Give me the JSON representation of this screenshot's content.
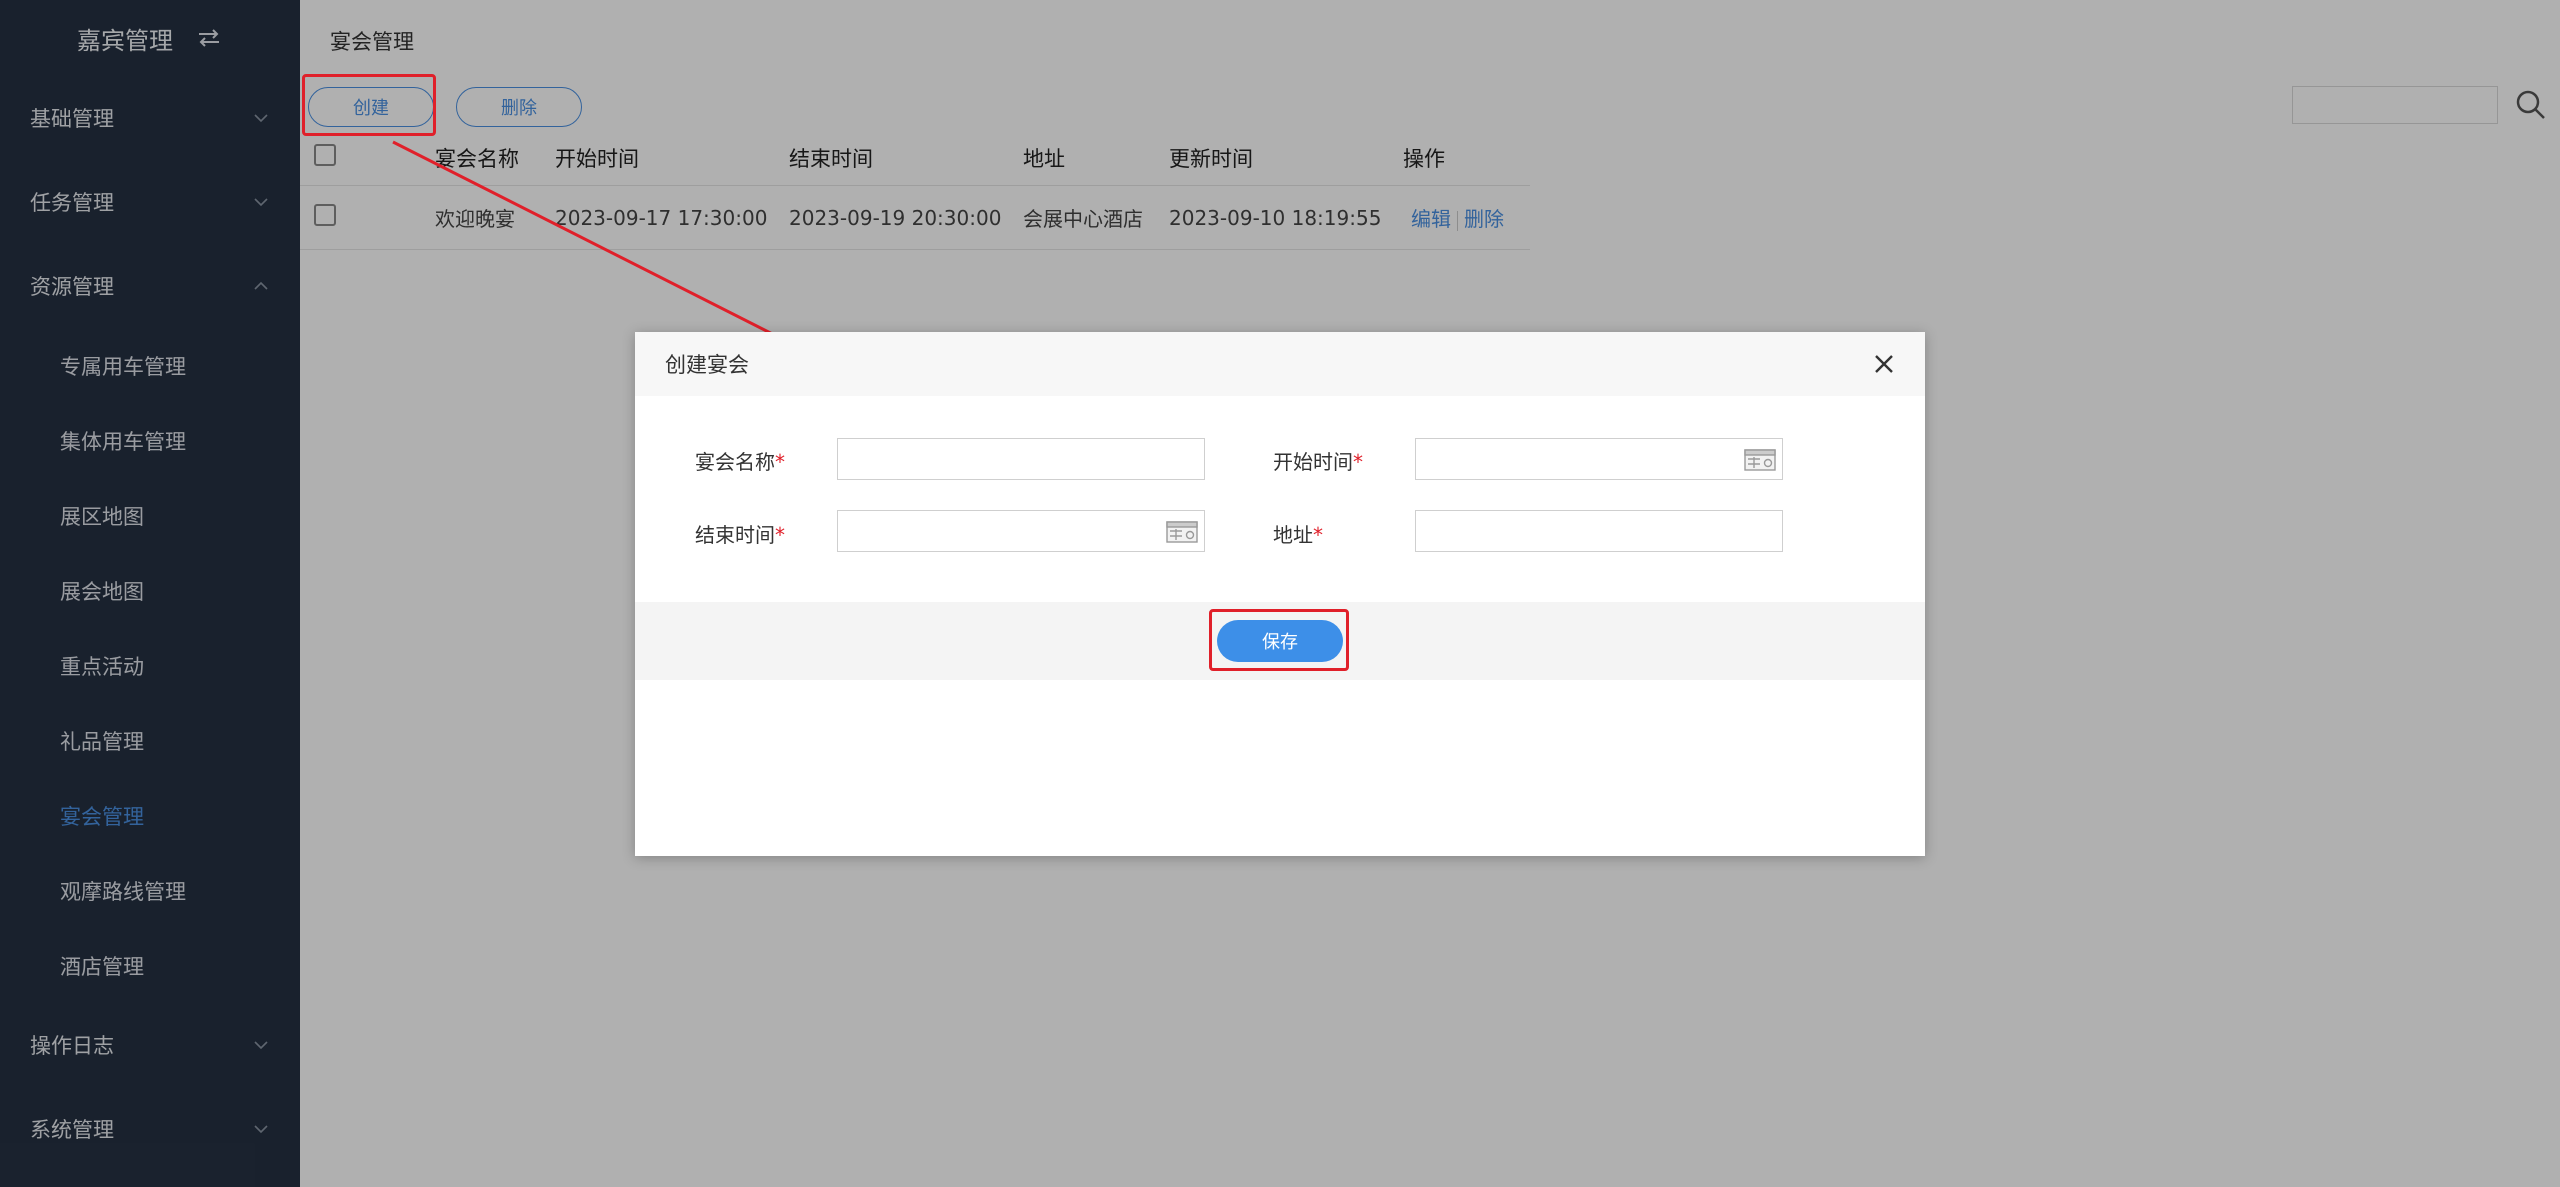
{
  "sidebar": {
    "title": "嘉宾管理",
    "groups": [
      {
        "label": "基础管理"
      },
      {
        "label": "任务管理"
      },
      {
        "label": "资源管理"
      },
      {
        "label": "操作日志"
      },
      {
        "label": "系统管理"
      }
    ],
    "sub_items": [
      {
        "label": "专属用车管理"
      },
      {
        "label": "集体用车管理"
      },
      {
        "label": "展区地图"
      },
      {
        "label": "展会地图"
      },
      {
        "label": "重点活动"
      },
      {
        "label": "礼品管理"
      },
      {
        "label": "宴会管理"
      },
      {
        "label": "观摩路线管理"
      },
      {
        "label": "酒店管理"
      }
    ]
  },
  "main": {
    "title": "宴会管理",
    "create_label": "创建",
    "delete_label": "删除",
    "table": {
      "headers": [
        "宴会名称",
        "开始时间",
        "结束时间",
        "地址",
        "更新时间",
        "操作"
      ],
      "rows": [
        {
          "name": "欢迎晚宴",
          "start": "2023-09-17 17:30:00",
          "end": "2023-09-19 20:30:00",
          "address": "会展中心酒店",
          "updated": "2023-09-10 18:19:55",
          "edit": "编辑",
          "delete": "删除"
        }
      ]
    }
  },
  "modal": {
    "title": "创建宴会",
    "fields": {
      "name": "宴会名称",
      "start": "开始时间",
      "end": "结束时间",
      "address": "地址"
    },
    "required_mark": "*",
    "save_label": "保存"
  },
  "colors": {
    "sidebar_bg": "#253142",
    "accent": "#4a90e2",
    "highlight": "#e0202a"
  }
}
